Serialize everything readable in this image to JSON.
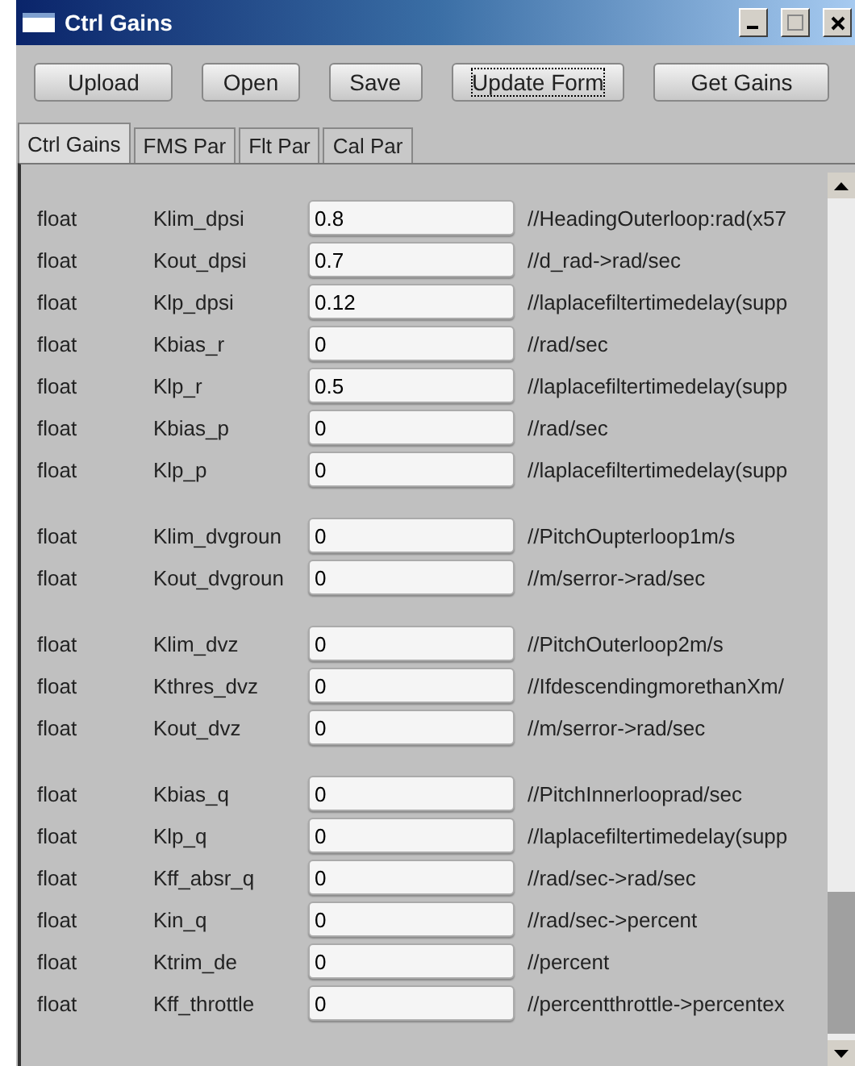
{
  "window": {
    "title": "Ctrl Gains"
  },
  "buttons": [
    {
      "label": "Upload",
      "focused": false
    },
    {
      "label": "Open",
      "focused": false
    },
    {
      "label": "Save",
      "focused": false
    },
    {
      "label": "Update Form",
      "focused": true
    },
    {
      "label": "Get Gains",
      "focused": false
    }
  ],
  "tabs": [
    {
      "label": "Ctrl Gains",
      "selected": true
    },
    {
      "label": "FMS Par",
      "selected": false
    },
    {
      "label": "Flt Par",
      "selected": false
    },
    {
      "label": "Cal Par",
      "selected": false
    }
  ],
  "groups": [
    {
      "rows": [
        {
          "type": "float",
          "name": "Klim_dpsi",
          "value": "0.8",
          "comment": "//HeadingOuterloop:rad(x57"
        },
        {
          "type": "float",
          "name": "Kout_dpsi",
          "value": "0.7",
          "comment": "//d_rad->rad/sec"
        },
        {
          "type": "float",
          "name": "Klp_dpsi",
          "value": "0.12",
          "comment": "//laplacefiltertimedelay(supp"
        },
        {
          "type": "float",
          "name": "Kbias_r",
          "value": "0",
          "comment": "//rad/sec"
        },
        {
          "type": "float",
          "name": "Klp_r",
          "value": "0.5",
          "comment": "//laplacefiltertimedelay(supp"
        },
        {
          "type": "float",
          "name": "Kbias_p",
          "value": "0",
          "comment": "//rad/sec"
        },
        {
          "type": "float",
          "name": "Klp_p",
          "value": "0",
          "comment": "//laplacefiltertimedelay(supp"
        }
      ]
    },
    {
      "rows": [
        {
          "type": "float",
          "name": "Klim_dvgroun",
          "value": "0",
          "comment": "//PitchOupterloop1m/s"
        },
        {
          "type": "float",
          "name": "Kout_dvgroun",
          "value": "0",
          "comment": "//m/serror->rad/sec"
        }
      ]
    },
    {
      "rows": [
        {
          "type": "float",
          "name": "Klim_dvz",
          "value": "0",
          "comment": "//PitchOuterloop2m/s"
        },
        {
          "type": "float",
          "name": "Kthres_dvz",
          "value": "0",
          "comment": "//IfdescendingmorethanXm/"
        },
        {
          "type": "float",
          "name": "Kout_dvz",
          "value": "0",
          "comment": "//m/serror->rad/sec"
        }
      ]
    },
    {
      "rows": [
        {
          "type": "float",
          "name": "Kbias_q",
          "value": "0",
          "comment": "//PitchInnerlooprad/sec"
        },
        {
          "type": "float",
          "name": "Klp_q",
          "value": "0",
          "comment": "//laplacefiltertimedelay(supp"
        },
        {
          "type": "float",
          "name": "Kff_absr_q",
          "value": "0",
          "comment": "//rad/sec->rad/sec"
        },
        {
          "type": "float",
          "name": "Kin_q",
          "value": "0",
          "comment": "//rad/sec->percent"
        },
        {
          "type": "float",
          "name": "Ktrim_de",
          "value": "0",
          "comment": "//percent"
        },
        {
          "type": "float",
          "name": "Kff_throttle",
          "value": "0",
          "comment": "//percentthrottle->percentex"
        }
      ]
    }
  ]
}
